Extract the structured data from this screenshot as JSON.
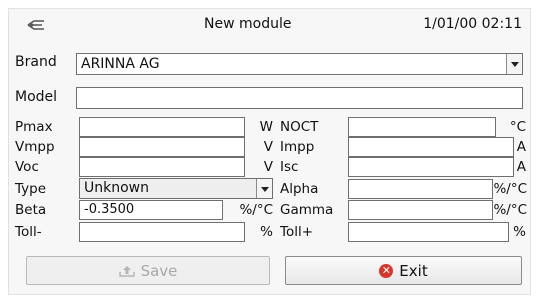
{
  "header": {
    "title": "New module",
    "datetime": "1/01/00 02:11",
    "icon": "module-icon"
  },
  "brand": {
    "label": "Brand",
    "value": "ARINNA AG"
  },
  "model": {
    "label": "Model",
    "value": ""
  },
  "left_fields": [
    {
      "label": "Pmax",
      "value": "",
      "unit": "W"
    },
    {
      "label": "Vmpp",
      "value": "",
      "unit": "V"
    },
    {
      "label": "Voc",
      "value": "",
      "unit": "V"
    }
  ],
  "right_fields": [
    {
      "label": "NOCT",
      "value": "",
      "unit": "°C"
    },
    {
      "label": "Impp",
      "value": "",
      "unit": "A"
    },
    {
      "label": "Isc",
      "value": "",
      "unit": "A"
    },
    {
      "label": "Alpha",
      "value": "",
      "unit": "%/°C"
    },
    {
      "label": "Gamma",
      "value": "",
      "unit": "%/°C"
    },
    {
      "label": "Toll+",
      "value": "",
      "unit": "%"
    }
  ],
  "type": {
    "label": "Type",
    "value": "Unknown"
  },
  "beta": {
    "label": "Beta",
    "value": "-0.3500",
    "unit": "%/°C"
  },
  "tollminus": {
    "label": "Toll-",
    "value": "",
    "unit": "%"
  },
  "buttons": {
    "save": {
      "label": "Save",
      "enabled": false,
      "icon": "save-icon"
    },
    "exit": {
      "label": "Exit",
      "enabled": true,
      "icon": "exit-icon"
    }
  },
  "colors": {
    "exit_icon": "#d9342b",
    "disabled_text": "#a8a8a8"
  }
}
